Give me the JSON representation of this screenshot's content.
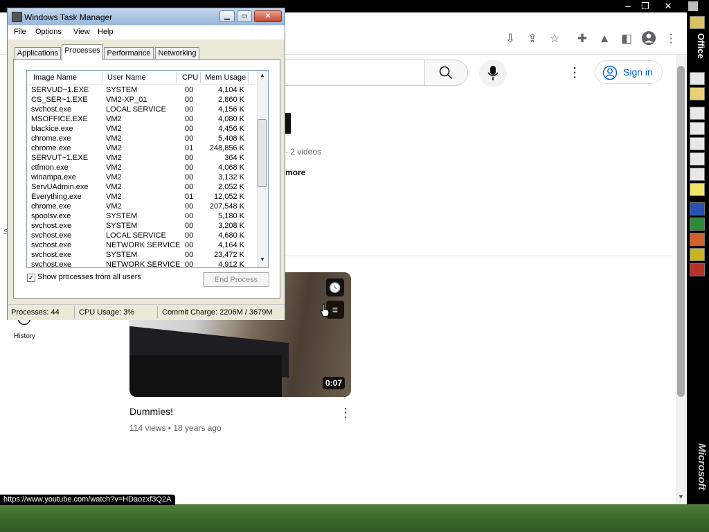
{
  "browser": {
    "window_controls": {
      "minimize": "–",
      "restore": "❐",
      "close": "✕"
    },
    "toolbar_icons": [
      "install-icon",
      "share-icon",
      "star-icon",
      "extensions-icon",
      "labs-icon",
      "sidebar-icon",
      "profile-icon",
      "menu-icon"
    ],
    "status_url": "https://www.youtube.com/watch?v=HDaozxf3Q2A"
  },
  "youtube": {
    "sign_in_label": "Sign in",
    "channel_videos": "· 2 videos",
    "channel_more": "more",
    "left_fragment": "S",
    "history_label": "History",
    "video": {
      "title": "Dummies!",
      "meta": "114 views • 18 years ago",
      "duration": "0:07"
    }
  },
  "office_bar": {
    "top_label": "Office",
    "bottom_label": "Microsoft"
  },
  "task_manager": {
    "title": "Windows Task Manager",
    "menu": [
      "File",
      "Options",
      "View",
      "Help"
    ],
    "tabs": [
      "Applications",
      "Processes",
      "Performance",
      "Networking"
    ],
    "active_tab": "Processes",
    "columns": [
      "Image Name",
      "User Name",
      "CPU",
      "Mem Usage"
    ],
    "processes": [
      {
        "name": "SERVUD~1.EXE",
        "user": "SYSTEM",
        "cpu": "00",
        "mem": "4,104 K"
      },
      {
        "name": "CS_SER~1.EXE",
        "user": "VM2-XP_01",
        "cpu": "00",
        "mem": "2,860 K"
      },
      {
        "name": "svchost.exe",
        "user": "LOCAL SERVICE",
        "cpu": "00",
        "mem": "4,156 K"
      },
      {
        "name": "MSOFFICE.EXE",
        "user": "VM2",
        "cpu": "00",
        "mem": "4,080 K"
      },
      {
        "name": "blackice.exe",
        "user": "VM2",
        "cpu": "00",
        "mem": "4,456 K"
      },
      {
        "name": "chrome.exe",
        "user": "VM2",
        "cpu": "00",
        "mem": "5,408 K"
      },
      {
        "name": "chrome.exe",
        "user": "VM2",
        "cpu": "01",
        "mem": "248,856 K"
      },
      {
        "name": "SERVUT~1.EXE",
        "user": "VM2",
        "cpu": "00",
        "mem": "364 K"
      },
      {
        "name": "ctfmon.exe",
        "user": "VM2",
        "cpu": "00",
        "mem": "4,068 K"
      },
      {
        "name": "winampa.exe",
        "user": "VM2",
        "cpu": "00",
        "mem": "3,132 K"
      },
      {
        "name": "ServUAdmin.exe",
        "user": "VM2",
        "cpu": "00",
        "mem": "2,052 K"
      },
      {
        "name": "Everything.exe",
        "user": "VM2",
        "cpu": "01",
        "mem": "12,052 K"
      },
      {
        "name": "chrome.exe",
        "user": "VM2",
        "cpu": "00",
        "mem": "207,548 K"
      },
      {
        "name": "spoolsv.exe",
        "user": "SYSTEM",
        "cpu": "00",
        "mem": "5,180 K"
      },
      {
        "name": "svchost.exe",
        "user": "SYSTEM",
        "cpu": "00",
        "mem": "3,208 K"
      },
      {
        "name": "svchost.exe",
        "user": "LOCAL SERVICE",
        "cpu": "00",
        "mem": "4,680 K"
      },
      {
        "name": "svchost.exe",
        "user": "NETWORK SERVICE",
        "cpu": "00",
        "mem": "4,164 K"
      },
      {
        "name": "svchost.exe",
        "user": "SYSTEM",
        "cpu": "00",
        "mem": "23,472 K"
      },
      {
        "name": "svchost.exe",
        "user": "NETWORK SERVICE",
        "cpu": "00",
        "mem": "4,912 K"
      }
    ],
    "show_all_label": "Show processes from all users",
    "show_all_checked": true,
    "end_process_label": "End Process",
    "status": {
      "processes": "Processes: 44",
      "cpu": "CPU Usage: 3%",
      "commit": "Commit Charge: 2206M / 3679M"
    }
  },
  "colors": {
    "yt_link": "#065fd4",
    "xp_title": "#a9c3e1",
    "close_red": "#c8472e"
  }
}
